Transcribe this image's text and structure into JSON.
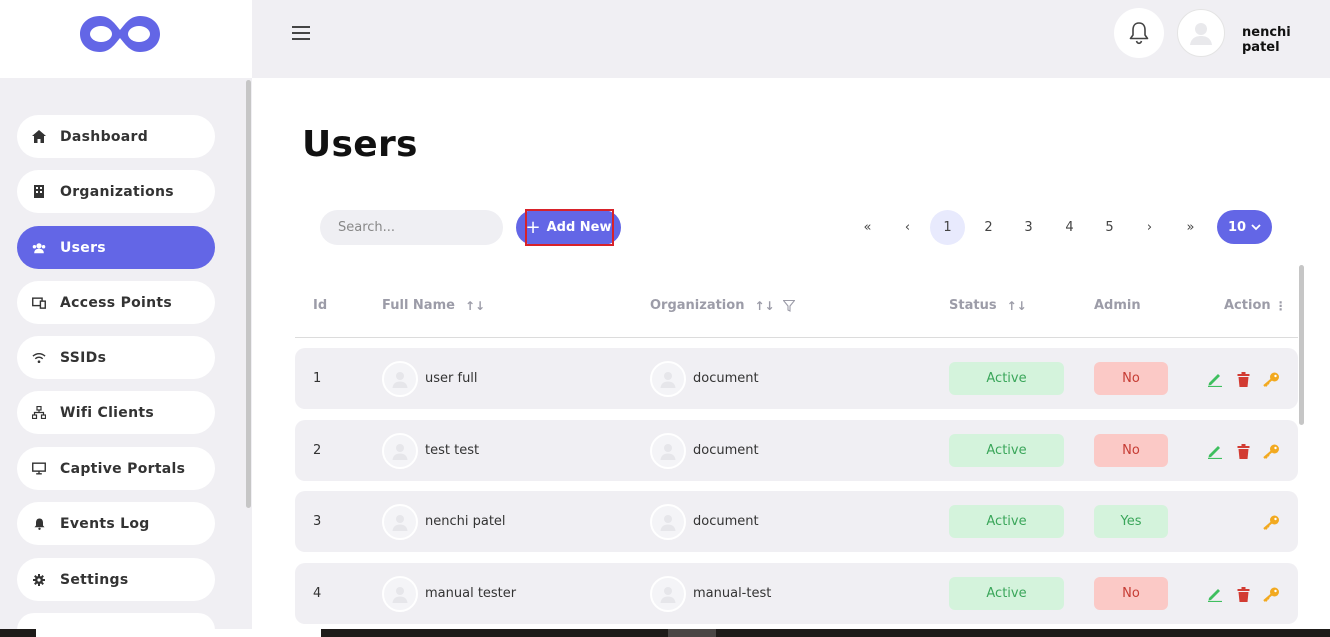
{
  "app": {
    "brand_color": "#6366e6",
    "logo_icon": "infinity-logo"
  },
  "sidebar": {
    "items": [
      {
        "label": "Dashboard",
        "icon": "home-icon"
      },
      {
        "label": "Organizations",
        "icon": "building-icon"
      },
      {
        "label": "Users",
        "icon": "users-icon",
        "active": true
      },
      {
        "label": "Access Points",
        "icon": "devices-icon"
      },
      {
        "label": "SSIDs",
        "icon": "wifi-icon"
      },
      {
        "label": "Wifi Clients",
        "icon": "network-icon"
      },
      {
        "label": "Captive Portals",
        "icon": "monitor-icon"
      },
      {
        "label": "Events Log",
        "icon": "bell-icon"
      },
      {
        "label": "Settings",
        "icon": "gear-icon"
      }
    ]
  },
  "header": {
    "user_name": "nenchi patel"
  },
  "main": {
    "title": "Users",
    "search_placeholder": "Search...",
    "add_button_label": "Add New",
    "pagination": {
      "first": "«",
      "prev": "‹",
      "pages": [
        "1",
        "2",
        "3",
        "4",
        "5"
      ],
      "current": "1",
      "next": "›",
      "last": "»",
      "per_page": "10"
    },
    "table": {
      "columns": [
        "Id",
        "Full Name",
        "Organization",
        "Status",
        "Admin",
        "Action"
      ],
      "rows": [
        {
          "id": "1",
          "full_name": "user full",
          "organization": "document",
          "status": "Active",
          "admin": "No",
          "actions": [
            "edit",
            "delete",
            "key"
          ]
        },
        {
          "id": "2",
          "full_name": "test test",
          "organization": "document",
          "status": "Active",
          "admin": "No",
          "actions": [
            "edit",
            "delete",
            "key"
          ]
        },
        {
          "id": "3",
          "full_name": "nenchi patel",
          "organization": "document",
          "status": "Active",
          "admin": "Yes",
          "actions": [
            "key"
          ]
        },
        {
          "id": "4",
          "full_name": "manual tester",
          "organization": "manual-test",
          "status": "Active",
          "admin": "No",
          "actions": [
            "edit",
            "delete",
            "key"
          ]
        }
      ]
    }
  },
  "colors": {
    "active_bg": "#d4f3dc",
    "active_text": "#3aa65a",
    "no_bg": "#fbc9c6",
    "no_text": "#c63c34",
    "edit_icon": "#3fbf5f",
    "delete_icon": "#d23b32",
    "key_icon": "#f2a91f"
  }
}
